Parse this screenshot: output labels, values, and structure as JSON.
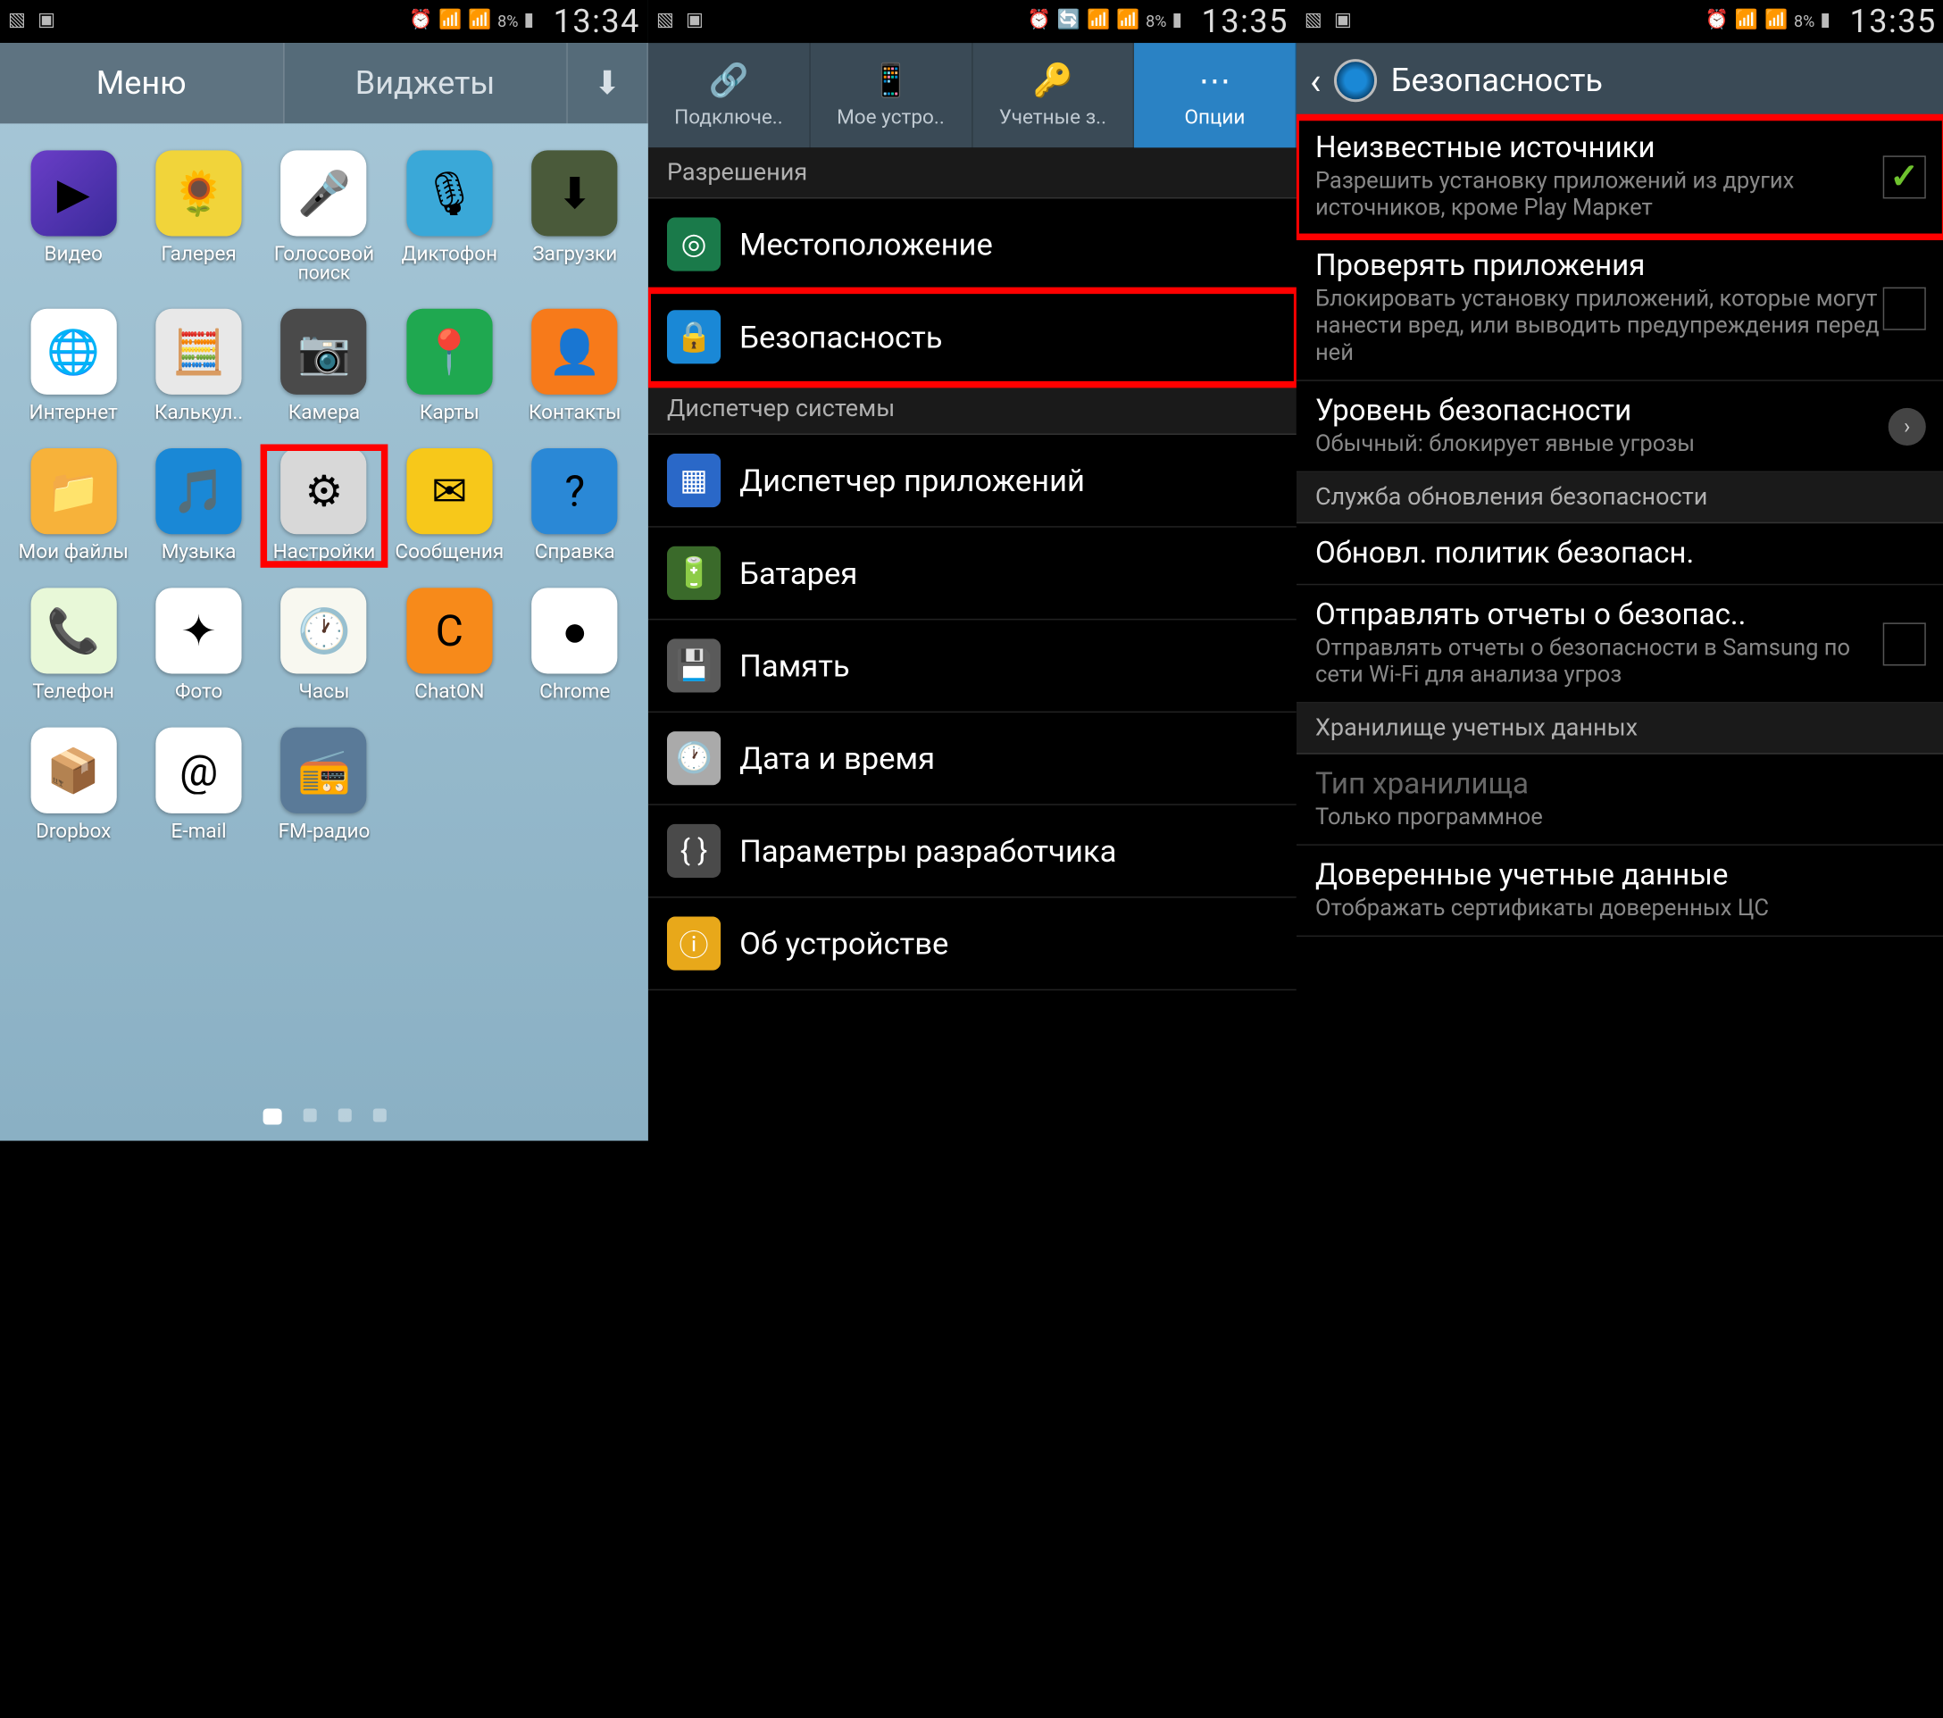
{
  "status": {
    "time_a": "13:34",
    "time_b": "13:35",
    "battery": "8%"
  },
  "s1": {
    "tabs": {
      "menu": "Меню",
      "widgets": "Виджеты"
    },
    "apps": [
      {
        "name": "video",
        "label": "Видео",
        "bg": "linear-gradient(135deg,#6a3ec7,#3a2a9a)",
        "glyph": "▶"
      },
      {
        "name": "gallery",
        "label": "Галерея",
        "bg": "#f1d43a",
        "glyph": "🌻"
      },
      {
        "name": "voice-search",
        "label": "Голосовой",
        "label2": "поиск",
        "bg": "#fff",
        "glyph": "🎤"
      },
      {
        "name": "recorder",
        "label": "Диктофон",
        "bg": "#3aa8d8",
        "glyph": "🎙"
      },
      {
        "name": "downloads",
        "label": "Загрузки",
        "bg": "#4a5a3a",
        "glyph": "⬇"
      },
      {
        "name": "internet",
        "label": "Интернет",
        "bg": "#fff",
        "glyph": "🌐"
      },
      {
        "name": "calculator",
        "label": "Калькул..",
        "bg": "#e8e8e8",
        "glyph": "🧮"
      },
      {
        "name": "camera",
        "label": "Камера",
        "bg": "#4a4a4a",
        "glyph": "📷"
      },
      {
        "name": "maps",
        "label": "Карты",
        "bg": "#1fa850",
        "glyph": "📍"
      },
      {
        "name": "contacts",
        "label": "Контакты",
        "bg": "#f77a1a",
        "glyph": "👤"
      },
      {
        "name": "my-files",
        "label": "Мои файлы",
        "bg": "#f7b23a",
        "glyph": "📁"
      },
      {
        "name": "music",
        "label": "Музыка",
        "bg": "#1a88d6",
        "glyph": "🎵"
      },
      {
        "name": "settings",
        "label": "Настройки",
        "bg": "#d8d8d8",
        "glyph": "⚙",
        "hl": true
      },
      {
        "name": "messages",
        "label": "Сообщения",
        "bg": "#f7c81a",
        "glyph": "✉"
      },
      {
        "name": "help",
        "label": "Справка",
        "bg": "#2a88d6",
        "glyph": "?"
      },
      {
        "name": "phone",
        "label": "Телефон",
        "bg": "#e8f8d8",
        "glyph": "📞"
      },
      {
        "name": "photos",
        "label": "Фото",
        "bg": "#fff",
        "glyph": "✦"
      },
      {
        "name": "clock",
        "label": "Часы",
        "bg": "#f8f8f0",
        "glyph": "🕐"
      },
      {
        "name": "chaton",
        "label": "ChatON",
        "bg": "#f78a1a",
        "glyph": "C"
      },
      {
        "name": "chrome",
        "label": "Chrome",
        "bg": "#fff",
        "glyph": "●"
      },
      {
        "name": "dropbox",
        "label": "Dropbox",
        "bg": "#fff",
        "glyph": "📦"
      },
      {
        "name": "email",
        "label": "E-mail",
        "bg": "#fff",
        "glyph": "@"
      },
      {
        "name": "fm-radio",
        "label": "FM-радио",
        "bg": "#5a7a98",
        "glyph": "📻"
      }
    ]
  },
  "s2": {
    "tabs": [
      "Подключе..",
      "Мое устро..",
      "Учетные з..",
      "Опции"
    ],
    "sections": [
      {
        "header": "Разрешения",
        "rows": [
          {
            "name": "location",
            "label": "Местоположение",
            "bg": "#1a7a4a",
            "glyph": "◎"
          },
          {
            "name": "security",
            "label": "Безопасность",
            "bg": "#1a88d6",
            "glyph": "🔒",
            "hl": true
          }
        ]
      },
      {
        "header": "Диспетчер системы",
        "rows": [
          {
            "name": "app-manager",
            "label": "Диспетчер приложений",
            "bg": "#2a68c8",
            "glyph": "▦"
          },
          {
            "name": "battery",
            "label": "Батарея",
            "bg": "#3a6a2a",
            "glyph": "🔋"
          },
          {
            "name": "storage",
            "label": "Память",
            "bg": "#5a5a5a",
            "glyph": "💾"
          },
          {
            "name": "date-time",
            "label": "Дата и время",
            "bg": "#aaa",
            "glyph": "🕐"
          },
          {
            "name": "developer",
            "label": "Параметры разработчика",
            "bg": "#4a4a4a",
            "glyph": "{ }"
          },
          {
            "name": "about",
            "label": "Об устройстве",
            "bg": "#e8a81a",
            "glyph": "ⓘ"
          }
        ]
      }
    ]
  },
  "s3": {
    "title": "Безопасность",
    "rows": [
      {
        "name": "unknown-sources",
        "title": "Неизвестные источники",
        "sub": "Разрешить установку приложений из других источников, кроме Play Маркет",
        "check": true,
        "checked": true,
        "hl": true
      },
      {
        "name": "verify-apps",
        "title": "Проверять приложения",
        "sub": "Блокировать установку приложений, которые могут нанести вред, или выводить предупреждения перед ней",
        "check": true,
        "checked": false
      },
      {
        "name": "security-level",
        "title": "Уровень безопасности",
        "sub": "Обычный: блокирует явные угрозы",
        "arrow": true
      },
      {
        "header": "Служба обновления безопасности"
      },
      {
        "name": "update-policy",
        "title": "Обновл. политик безопасн."
      },
      {
        "name": "send-reports",
        "title": "Отправлять отчеты о безопас..",
        "sub": "Отправлять отчеты о безопасности в Samsung по сети Wi-Fi для анализа угроз",
        "check": true,
        "checked": false
      },
      {
        "header": "Хранилище учетных данных"
      },
      {
        "name": "storage-type",
        "title": "Тип хранилища",
        "sub": "Только программное",
        "disabled": true
      },
      {
        "name": "trusted-creds",
        "title": "Доверенные учетные данные",
        "sub": "Отображать сертификаты доверенных ЦС"
      }
    ]
  }
}
